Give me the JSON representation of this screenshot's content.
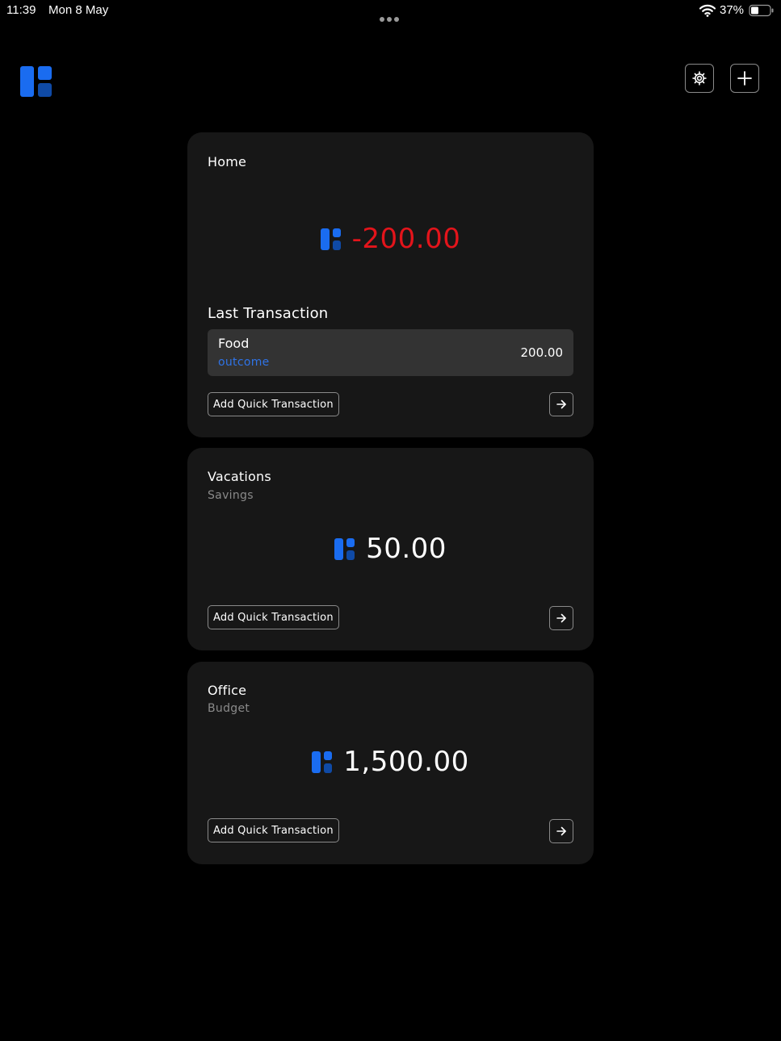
{
  "status_bar": {
    "time": "11:39",
    "date": "Mon 8 May",
    "battery_percent": "37%"
  },
  "header": {
    "logo_icon": "app-logo-icon",
    "settings_icon": "gear-icon",
    "add_icon": "plus-icon"
  },
  "colors": {
    "accent": "#1a6cf0",
    "negative": "#e3141b",
    "outcome_label": "#2f73e6",
    "card_bg": "#171717"
  },
  "accounts": [
    {
      "name": "Home",
      "subtitle": "",
      "balance": "-200.00",
      "last_transaction_heading": "Last Transaction",
      "last_transaction": {
        "name": "Food",
        "type": "outcome",
        "amount": "200.00"
      },
      "quick_button_label": "Add Quick Transaction"
    },
    {
      "name": "Vacations",
      "subtitle": "Savings",
      "balance": "50.00",
      "quick_button_label": "Add Quick Transaction"
    },
    {
      "name": "Office",
      "subtitle": "Budget",
      "balance": "1,500.00",
      "quick_button_label": "Add Quick Transaction"
    }
  ]
}
